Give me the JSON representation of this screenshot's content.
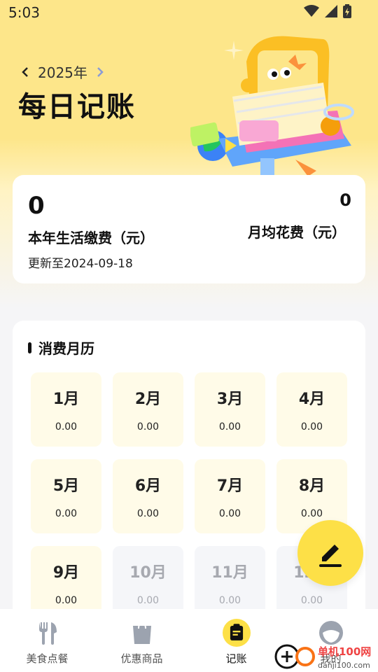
{
  "status_bar": {
    "time": "5:03"
  },
  "header": {
    "year": "2025年",
    "title": "每日记账"
  },
  "summary": {
    "annual_total": "0",
    "annual_label": "本年生活缴费（元）",
    "updated_text": "更新至2024-09-18",
    "monthly_avg": "0",
    "monthly_avg_label": "月均花费（元）"
  },
  "calendar": {
    "title": "消费月历",
    "months": [
      {
        "name": "1月",
        "amount": "0.00"
      },
      {
        "name": "2月",
        "amount": "0.00"
      },
      {
        "name": "3月",
        "amount": "0.00"
      },
      {
        "name": "4月",
        "amount": "0.00"
      },
      {
        "name": "5月",
        "amount": "0.00"
      },
      {
        "name": "6月",
        "amount": "0.00"
      },
      {
        "name": "7月",
        "amount": "0.00"
      },
      {
        "name": "8月",
        "amount": "0.00"
      },
      {
        "name": "9月",
        "amount": "0.00"
      },
      {
        "name": "10月",
        "amount": "0.00"
      },
      {
        "name": "11月",
        "amount": "0.00"
      },
      {
        "name": "12月",
        "amount": "0.00"
      }
    ]
  },
  "nav": {
    "items": [
      {
        "label": "美食点餐",
        "icon": "fork-knife-icon"
      },
      {
        "label": "优惠商品",
        "icon": "shopping-bag-icon"
      },
      {
        "label": "记账",
        "icon": "ledger-icon"
      },
      {
        "label": "我的",
        "icon": "profile-icon"
      }
    ],
    "active_index": 2
  },
  "watermark": {
    "text": "单机100网",
    "url_text": "danji100.com"
  },
  "colors": {
    "accent": "#fde047",
    "hero": "#fde68a",
    "month_active": "#fffbe8",
    "month_future": "#f5f6f9"
  }
}
